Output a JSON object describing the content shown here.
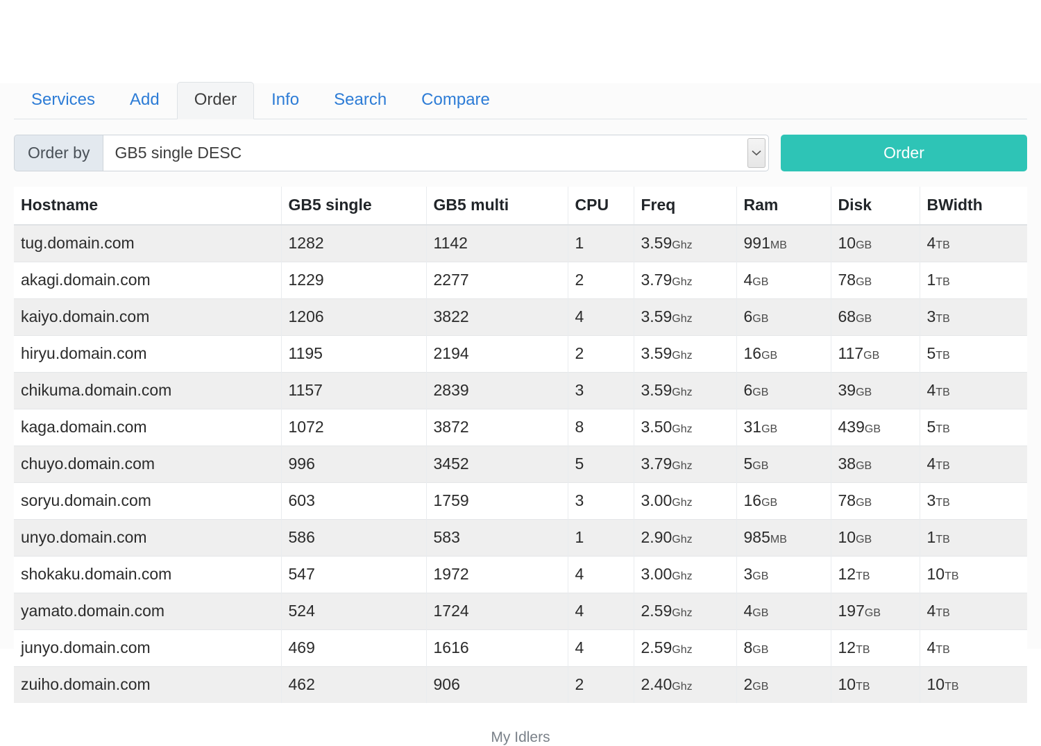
{
  "nav": {
    "tabs": [
      {
        "label": "Services",
        "active": false
      },
      {
        "label": "Add",
        "active": false
      },
      {
        "label": "Order",
        "active": true
      },
      {
        "label": "Info",
        "active": false
      },
      {
        "label": "Search",
        "active": false
      },
      {
        "label": "Compare",
        "active": false
      }
    ]
  },
  "order_form": {
    "label": "Order by",
    "selected_option": "GB5 single DESC",
    "submit_label": "Order",
    "accent_color": "#2ec4b6"
  },
  "table": {
    "columns": [
      "Hostname",
      "GB5 single",
      "GB5 multi",
      "CPU",
      "Freq",
      "Ram",
      "Disk",
      "BWidth"
    ],
    "rows": [
      {
        "hostname": "tug.domain.com",
        "gb5_single": "1282",
        "gb5_multi": "1142",
        "cpu": "1",
        "freq": "3.59",
        "freq_unit": "Ghz",
        "ram": "991",
        "ram_unit": "MB",
        "disk": "10",
        "disk_unit": "GB",
        "bwidth": "4",
        "bwidth_unit": "TB"
      },
      {
        "hostname": "akagi.domain.com",
        "gb5_single": "1229",
        "gb5_multi": "2277",
        "cpu": "2",
        "freq": "3.79",
        "freq_unit": "Ghz",
        "ram": "4",
        "ram_unit": "GB",
        "disk": "78",
        "disk_unit": "GB",
        "bwidth": "1",
        "bwidth_unit": "TB"
      },
      {
        "hostname": "kaiyo.domain.com",
        "gb5_single": "1206",
        "gb5_multi": "3822",
        "cpu": "4",
        "freq": "3.59",
        "freq_unit": "Ghz",
        "ram": "6",
        "ram_unit": "GB",
        "disk": "68",
        "disk_unit": "GB",
        "bwidth": "3",
        "bwidth_unit": "TB"
      },
      {
        "hostname": "hiryu.domain.com",
        "gb5_single": "1195",
        "gb5_multi": "2194",
        "cpu": "2",
        "freq": "3.59",
        "freq_unit": "Ghz",
        "ram": "16",
        "ram_unit": "GB",
        "disk": "117",
        "disk_unit": "GB",
        "bwidth": "5",
        "bwidth_unit": "TB"
      },
      {
        "hostname": "chikuma.domain.com",
        "gb5_single": "1157",
        "gb5_multi": "2839",
        "cpu": "3",
        "freq": "3.59",
        "freq_unit": "Ghz",
        "ram": "6",
        "ram_unit": "GB",
        "disk": "39",
        "disk_unit": "GB",
        "bwidth": "4",
        "bwidth_unit": "TB"
      },
      {
        "hostname": "kaga.domain.com",
        "gb5_single": "1072",
        "gb5_multi": "3872",
        "cpu": "8",
        "freq": "3.50",
        "freq_unit": "Ghz",
        "ram": "31",
        "ram_unit": "GB",
        "disk": "439",
        "disk_unit": "GB",
        "bwidth": "5",
        "bwidth_unit": "TB"
      },
      {
        "hostname": "chuyo.domain.com",
        "gb5_single": "996",
        "gb5_multi": "3452",
        "cpu": "5",
        "freq": "3.79",
        "freq_unit": "Ghz",
        "ram": "5",
        "ram_unit": "GB",
        "disk": "38",
        "disk_unit": "GB",
        "bwidth": "4",
        "bwidth_unit": "TB"
      },
      {
        "hostname": "soryu.domain.com",
        "gb5_single": "603",
        "gb5_multi": "1759",
        "cpu": "3",
        "freq": "3.00",
        "freq_unit": "Ghz",
        "ram": "16",
        "ram_unit": "GB",
        "disk": "78",
        "disk_unit": "GB",
        "bwidth": "3",
        "bwidth_unit": "TB"
      },
      {
        "hostname": "unyo.domain.com",
        "gb5_single": "586",
        "gb5_multi": "583",
        "cpu": "1",
        "freq": "2.90",
        "freq_unit": "Ghz",
        "ram": "985",
        "ram_unit": "MB",
        "disk": "10",
        "disk_unit": "GB",
        "bwidth": "1",
        "bwidth_unit": "TB"
      },
      {
        "hostname": "shokaku.domain.com",
        "gb5_single": "547",
        "gb5_multi": "1972",
        "cpu": "4",
        "freq": "3.00",
        "freq_unit": "Ghz",
        "ram": "3",
        "ram_unit": "GB",
        "disk": "12",
        "disk_unit": "TB",
        "bwidth": "10",
        "bwidth_unit": "TB"
      },
      {
        "hostname": "yamato.domain.com",
        "gb5_single": "524",
        "gb5_multi": "1724",
        "cpu": "4",
        "freq": "2.59",
        "freq_unit": "Ghz",
        "ram": "4",
        "ram_unit": "GB",
        "disk": "197",
        "disk_unit": "GB",
        "bwidth": "4",
        "bwidth_unit": "TB"
      },
      {
        "hostname": "junyo.domain.com",
        "gb5_single": "469",
        "gb5_multi": "1616",
        "cpu": "4",
        "freq": "2.59",
        "freq_unit": "Ghz",
        "ram": "8",
        "ram_unit": "GB",
        "disk": "12",
        "disk_unit": "TB",
        "bwidth": "4",
        "bwidth_unit": "TB"
      },
      {
        "hostname": "zuiho.domain.com",
        "gb5_single": "462",
        "gb5_multi": "906",
        "cpu": "2",
        "freq": "2.40",
        "freq_unit": "Ghz",
        "ram": "2",
        "ram_unit": "GB",
        "disk": "10",
        "disk_unit": "TB",
        "bwidth": "10",
        "bwidth_unit": "TB"
      }
    ]
  },
  "footer": {
    "text": "My Idlers"
  },
  "icons": {
    "dropdown": "chevron-down-icon"
  }
}
